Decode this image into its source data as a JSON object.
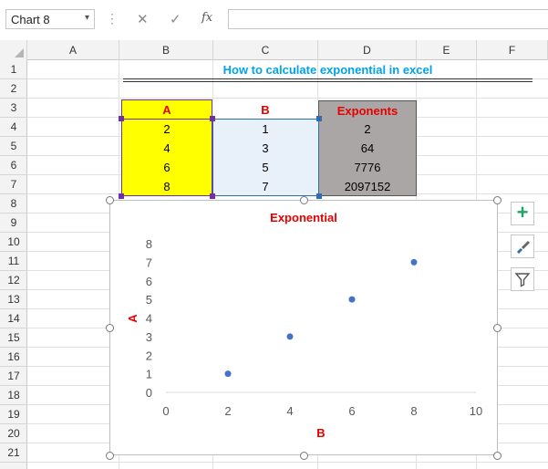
{
  "formula_bar": {
    "name_box": "Chart 8",
    "dropdown_glyph": "▾",
    "dots": "⋮",
    "cancel_glyph": "✕",
    "enter_glyph": "✓",
    "fx_glyph": "fx",
    "formula": ""
  },
  "columns": [
    "A",
    "B",
    "C",
    "D",
    "E",
    "F"
  ],
  "rows": [
    "1",
    "2",
    "3",
    "4",
    "5",
    "6",
    "7",
    "8",
    "9",
    "10",
    "11",
    "12",
    "13",
    "14",
    "15",
    "16",
    "17",
    "18",
    "19",
    "20",
    "21"
  ],
  "sheet_title": "How to calculate exponential in excel",
  "table": {
    "headers": [
      "A",
      "B",
      "Exponents"
    ],
    "rows": [
      [
        "2",
        "1",
        "2"
      ],
      [
        "4",
        "3",
        "64"
      ],
      [
        "6",
        "5",
        "7776"
      ],
      [
        "8",
        "7",
        "2097152"
      ]
    ]
  },
  "chart_tools": {
    "add_glyph": "+",
    "style_glyph": "🖌",
    "filter_glyph": "▼"
  },
  "colors": {
    "title": "#00a2e8",
    "header_red": "#e60000",
    "col_a_fill": "#ffff00",
    "col_b_fill": "#e8f0fa",
    "col_d_fill": "#aaa6a5",
    "point": "#4472c4"
  },
  "chart_data": {
    "type": "scatter",
    "title": "Exponential",
    "xlabel": "B",
    "ylabel": "A",
    "xlim": [
      0,
      10
    ],
    "ylim": [
      0,
      8
    ],
    "xticks": [
      0,
      2,
      4,
      6,
      8,
      10
    ],
    "yticks": [
      0,
      1,
      2,
      3,
      4,
      5,
      6,
      7,
      8
    ],
    "x": [
      2,
      4,
      6,
      8
    ],
    "y": [
      1,
      3,
      5,
      7
    ],
    "grid": false
  }
}
